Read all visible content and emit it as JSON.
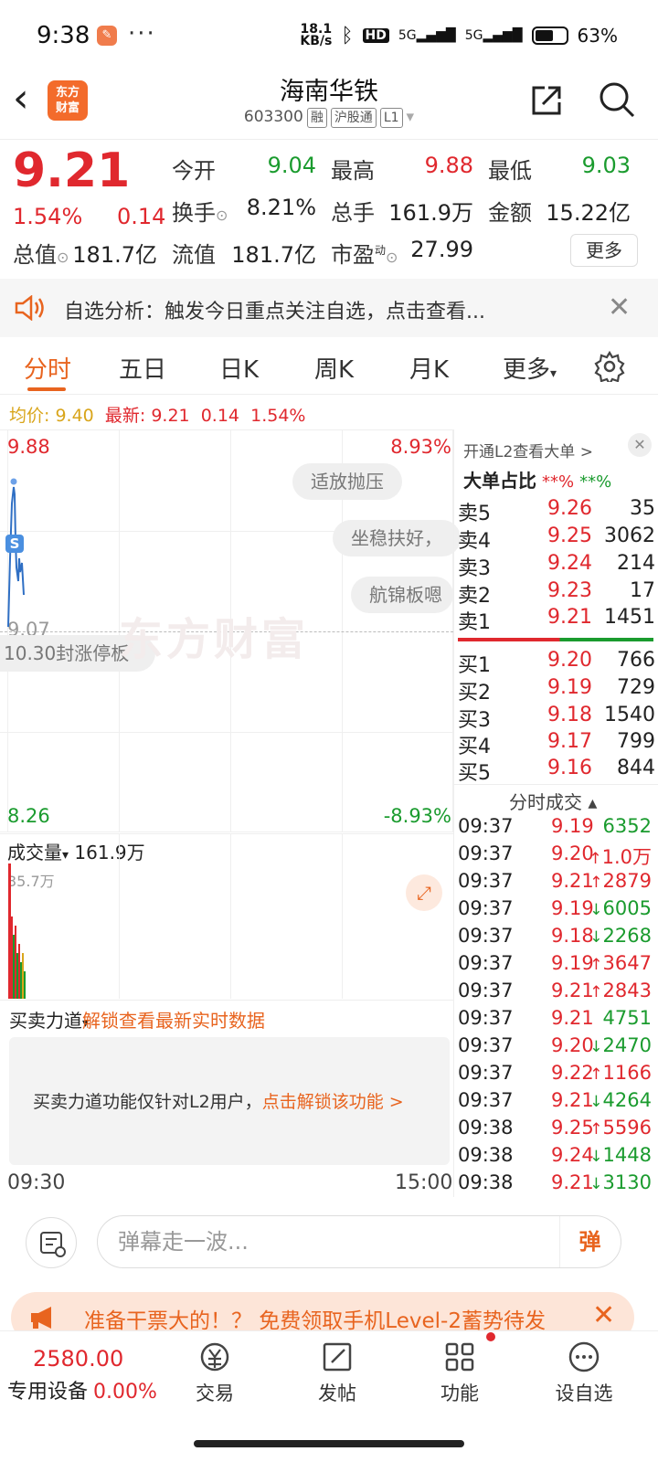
{
  "status": {
    "time": "9:38",
    "dots": "···",
    "net_top": "18.1",
    "net_bottom": "KB/s",
    "hd": "HD",
    "s1": "5G",
    "s2": "5G",
    "battery": "63%"
  },
  "header": {
    "title": "海南华铁",
    "code": "603300",
    "tag1": "融",
    "tag2": "沪股通",
    "tag3": "L1",
    "logo_top": "东方",
    "logo_bottom": "财富"
  },
  "quote": {
    "price": "9.21",
    "pct": "1.54%",
    "chg": "0.14",
    "open_l": "今开",
    "open_v": "9.04",
    "high_l": "最高",
    "high_v": "9.88",
    "low_l": "最低",
    "low_v": "9.03",
    "turn_l": "换手",
    "turn_v": "8.21%",
    "vol_l": "总手",
    "vol_v": "161.9万",
    "amt_l": "金额",
    "amt_v": "15.22亿",
    "mcap_l": "总值",
    "mcap_v": "181.7亿",
    "float_l": "流值",
    "float_v": "181.7亿",
    "pe_l": "市盈",
    "pe_sup": "动",
    "pe_v": "27.99",
    "more": "更多"
  },
  "notice": {
    "text": "自选分析：触发今日重点关注自选，点击查看..."
  },
  "tabs": [
    "分时",
    "五日",
    "日K",
    "周K",
    "月K",
    "更多"
  ],
  "avg": {
    "avg_l": "均价:",
    "avg_v": "9.40",
    "last_l": "最新:",
    "last_v": "9.21",
    "chg": "0.14",
    "pct": "1.54%"
  },
  "chart": {
    "top_price": "9.88",
    "top_pct": "8.93%",
    "bottom_price": "8.26",
    "bottom_pct": "-8.93%",
    "mid_label": "9.07",
    "s_marker": "S",
    "watermark": "东方财富",
    "bubbles": [
      "适放抛压",
      "坐稳扶好，",
      "航锦板嗯",
      "10.30封涨停板"
    ]
  },
  "volume": {
    "label": "成交量",
    "value": "161.9万",
    "max": "35.7万"
  },
  "buysell": {
    "label": "买卖力道",
    "lock": "解锁查看最新实时数据",
    "msg": "买卖力道功能仅针对L2用户，",
    "link": "点击解锁该功能 >"
  },
  "timeaxis": {
    "start": "09:30",
    "end": "15:00"
  },
  "side": {
    "head": "开通L2查看大单 >",
    "ratio_l": "大单占比",
    "ratio_a": "**%",
    "ratio_b": "**%",
    "asks": [
      {
        "l": "卖5",
        "p": "9.26",
        "v": "35"
      },
      {
        "l": "卖4",
        "p": "9.25",
        "v": "3062"
      },
      {
        "l": "卖3",
        "p": "9.24",
        "v": "214"
      },
      {
        "l": "卖2",
        "p": "9.23",
        "v": "17"
      },
      {
        "l": "卖1",
        "p": "9.21",
        "v": "1451"
      }
    ],
    "bids": [
      {
        "l": "买1",
        "p": "9.20",
        "v": "766"
      },
      {
        "l": "买2",
        "p": "9.19",
        "v": "729"
      },
      {
        "l": "买3",
        "p": "9.18",
        "v": "1540"
      },
      {
        "l": "买4",
        "p": "9.17",
        "v": "799"
      },
      {
        "l": "买5",
        "p": "9.16",
        "v": "844"
      }
    ],
    "ticks_head": "分时成交",
    "ticks": [
      {
        "t": "09:37",
        "p": "9.19",
        "v": "6352",
        "d": ""
      },
      {
        "t": "09:37",
        "p": "9.20",
        "v": "1.0万",
        "d": "up"
      },
      {
        "t": "09:37",
        "p": "9.21",
        "v": "2879",
        "d": "up"
      },
      {
        "t": "09:37",
        "p": "9.19",
        "v": "6005",
        "d": "down"
      },
      {
        "t": "09:37",
        "p": "9.18",
        "v": "2268",
        "d": "down"
      },
      {
        "t": "09:37",
        "p": "9.19",
        "v": "3647",
        "d": "up"
      },
      {
        "t": "09:37",
        "p": "9.21",
        "v": "2843",
        "d": "up"
      },
      {
        "t": "09:37",
        "p": "9.21",
        "v": "4751",
        "d": ""
      },
      {
        "t": "09:37",
        "p": "9.20",
        "v": "2470",
        "d": "down"
      },
      {
        "t": "09:37",
        "p": "9.22",
        "v": "1166",
        "d": "up"
      },
      {
        "t": "09:37",
        "p": "9.21",
        "v": "4264",
        "d": "down"
      },
      {
        "t": "09:38",
        "p": "9.25",
        "v": "5596",
        "d": "up"
      },
      {
        "t": "09:38",
        "p": "9.24",
        "v": "1448",
        "d": "down"
      },
      {
        "t": "09:38",
        "p": "9.21",
        "v": "3130",
        "d": "down"
      }
    ]
  },
  "danmu": {
    "placeholder": "弹幕走一波...",
    "btn": "弹"
  },
  "promo": {
    "text": "准备干票大的！？ 免费领取手机Level-2蓄势待发"
  },
  "bottom": {
    "index": "2580.00",
    "dev": "专用设备",
    "dev_pct": "0.00%",
    "items": [
      "交易",
      "发帖",
      "功能",
      "设自选"
    ]
  },
  "colors": {
    "up": "#e0282e",
    "down": "#1a9b2e",
    "accent": "#e8641f"
  }
}
